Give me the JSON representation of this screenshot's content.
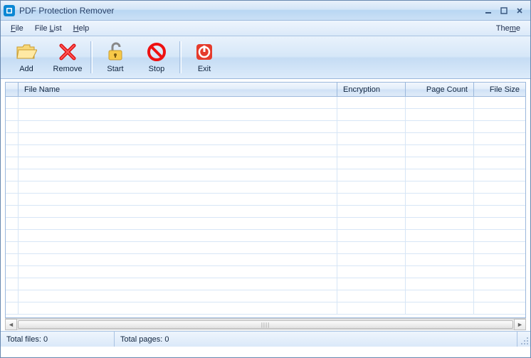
{
  "window": {
    "title": "PDF Protection Remover"
  },
  "menu": {
    "file": "File",
    "filelist": "File List",
    "help": "Help",
    "theme": "Theme"
  },
  "toolbar": {
    "add": "Add",
    "remove": "Remove",
    "start": "Start",
    "stop": "Stop",
    "exit": "Exit"
  },
  "columns": {
    "filename": "File Name",
    "encryption": "Encryption",
    "pagecount": "Page Count",
    "filesize": "File Size"
  },
  "status": {
    "totalfiles": "Total files: 0",
    "totalpages": "Total pages: 0"
  }
}
